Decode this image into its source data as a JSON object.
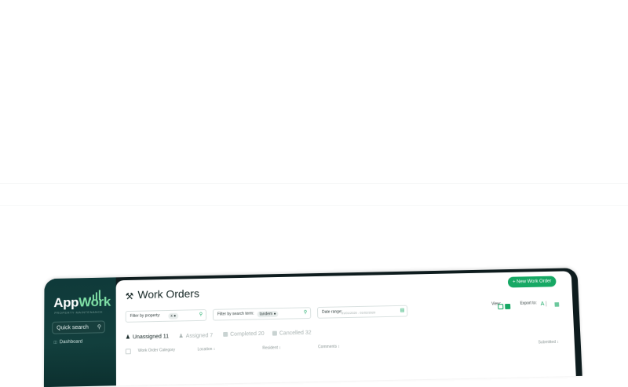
{
  "sidebar": {
    "logo_part1": "App",
    "logo_part2": "Work",
    "tagline": "PROPERTY MAINTENANCE",
    "quick_search": "Quick search",
    "nav_items": [
      {
        "label": "Dashboard"
      }
    ]
  },
  "header": {
    "title": "Work Orders",
    "new_button": "+ New Work Order"
  },
  "filters": {
    "property_label": "Filter by property:",
    "property_chip": "x",
    "search_label": "Filter by search term:",
    "search_chip": "tandem",
    "date_label": "Date range:",
    "date_value": "01/01/2020 - 01/02/2020"
  },
  "view": {
    "label": "View:"
  },
  "export": {
    "label": "Export to:",
    "pdf": "A",
    "separator": "|"
  },
  "tabs": [
    {
      "label": "Unassigned",
      "count": "11"
    },
    {
      "label": "Assigned",
      "count": "7"
    },
    {
      "label": "Completed",
      "count": "20"
    },
    {
      "label": "Cancelled",
      "count": "32"
    }
  ],
  "table": {
    "columns": [
      "Work Order Category",
      "Location ↕",
      "Resident ↕",
      "Comments ↕",
      "Submitted ↕"
    ]
  },
  "colors": {
    "accent": "#16a864",
    "sidebar": "#0f3a3a",
    "frame": "#0e1c1e"
  }
}
